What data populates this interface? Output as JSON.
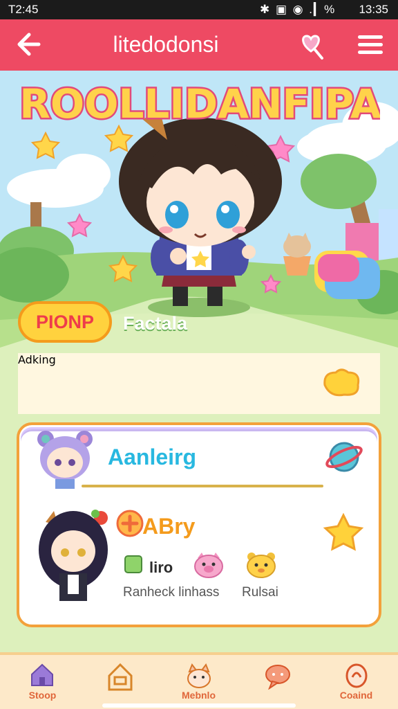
{
  "status_bar": {
    "time_left": "T2:45",
    "icons": "✱ ▣ ◉ .▎% ",
    "time_right": "13:35"
  },
  "app_bar": {
    "title": "litedodonsi",
    "icons": [
      "back-arrow-icon",
      "heart-lollipop-icon",
      "menu-icon"
    ]
  },
  "game": {
    "logo_text": "ROOLLIDANFIPA",
    "character_badge": "PIONP",
    "character_subtitle": "Factala",
    "card_one": {
      "label": "Adking"
    },
    "card_two": {
      "title": "Aanleirg",
      "subtitle": "ABry",
      "items": [
        {
          "label": "liro",
          "icon": "leaf-icon"
        },
        {
          "label": "",
          "icon": "pig-icon"
        },
        {
          "label": "",
          "icon": "bear-icon"
        }
      ],
      "captions": [
        "Ranheck linhass",
        "Rulsai"
      ]
    }
  },
  "bottom_nav": {
    "items": [
      {
        "label": "Stoop",
        "icon": "home-icon"
      },
      {
        "label": "",
        "icon": "house-icon"
      },
      {
        "label": "Mebnlo",
        "icon": "cat-icon"
      },
      {
        "label": "",
        "icon": "chat-bubble-icon"
      },
      {
        "label": "Coaind",
        "icon": "cookie-icon"
      }
    ]
  },
  "colors": {
    "appbar": "#ee4a63",
    "card_border": "#f3a13b",
    "accent_blue": "#28b8e0",
    "accent_orange": "#f49b1c"
  }
}
